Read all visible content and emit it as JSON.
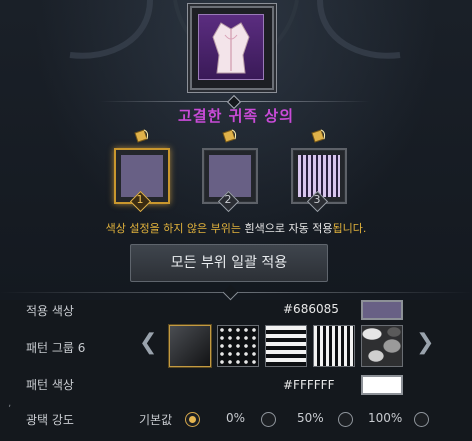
{
  "item": {
    "name": "고결한 귀족 상의"
  },
  "slots": [
    {
      "number": "1",
      "color": "#686085",
      "pattern": "solid",
      "state": "selected"
    },
    {
      "number": "2",
      "color": "#686085",
      "pattern": "solid",
      "state": "normal"
    },
    {
      "number": "3",
      "color": "#c9b6e0",
      "pattern": "vertical-stripes",
      "state": "normal"
    }
  ],
  "notice": {
    "part1": "색상 설정을 하지 않은 부위는 ",
    "highlight": "흰색",
    "part2": "으로 자동 적용",
    "part3": "됩니다."
  },
  "apply_all_label": "모든 부위 일괄 적용",
  "rows": {
    "applied_color": {
      "label": "적용 색상",
      "hex": "#686085",
      "swatch": "#686085"
    },
    "pattern_group": {
      "label": "패턴 그룹 6",
      "selected_index": 0,
      "patterns": [
        "gradient-dark",
        "dots",
        "horizontal-stripes",
        "vertical-stripes",
        "camouflage"
      ]
    },
    "pattern_color": {
      "label": "패턴 색상",
      "hex": "#FFFFFF",
      "swatch": "#FFFFFF"
    },
    "gloss": {
      "label": "광택 강도",
      "options": [
        "기본값",
        "0%",
        "50%",
        "100%"
      ],
      "selected": "기본값"
    }
  },
  "colors": {
    "accent": "#e1b23c",
    "item_name": "#c94bd8"
  }
}
